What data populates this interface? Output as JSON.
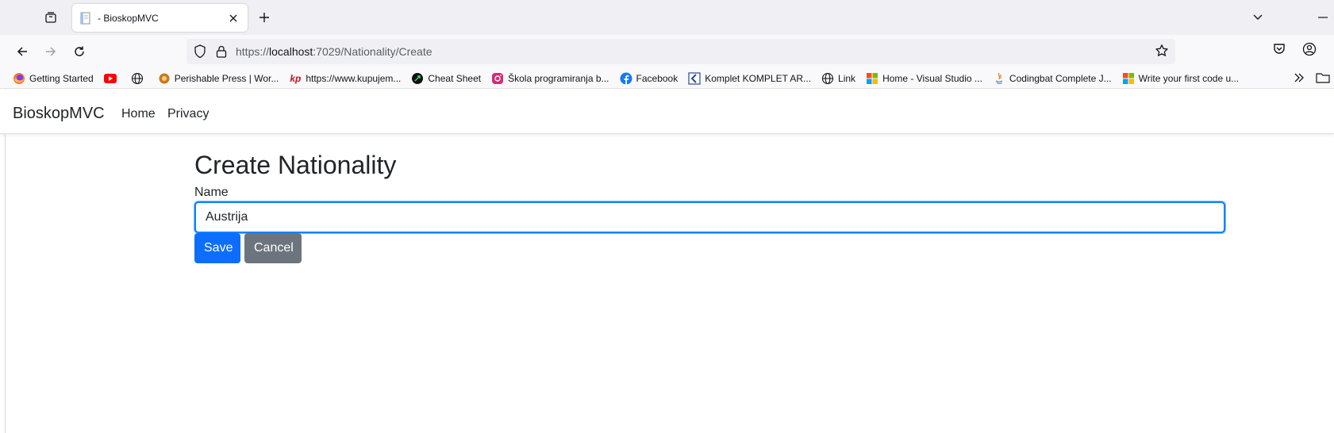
{
  "browser": {
    "tab": {
      "title": "- BioskopMVC"
    },
    "url": {
      "prefix": "https://",
      "host": "localhost",
      "rest": ":7029/Nationality/Create"
    },
    "bookmarks": [
      {
        "label": "Getting Started",
        "icon": "firefox-icon"
      },
      {
        "label": "",
        "icon": "youtube-icon"
      },
      {
        "label": "",
        "icon": "globe-icon"
      },
      {
        "label": "Perishable Press | Wor...",
        "icon": "perishable-icon"
      },
      {
        "label": "https://www.kupujem...",
        "icon": "kp-icon"
      },
      {
        "label": "Cheat Sheet",
        "icon": "cheatsheet-icon"
      },
      {
        "label": "Škola programiranja b...",
        "icon": "instagram-icon"
      },
      {
        "label": "Facebook",
        "icon": "facebook-icon"
      },
      {
        "label": "Komplet KOMPLET AR...",
        "icon": "komplet-icon"
      },
      {
        "label": "Link",
        "icon": "globe-icon"
      },
      {
        "label": "Home - Visual Studio ...",
        "icon": "microsoft-icon"
      },
      {
        "label": "Codingbat Complete J...",
        "icon": "java-icon"
      },
      {
        "label": "Write your first code u...",
        "icon": "microsoft-icon"
      }
    ]
  },
  "site": {
    "brand": "BioskopMVC",
    "nav": [
      "Home",
      "Privacy"
    ]
  },
  "form": {
    "title": "Create Nationality",
    "name_label": "Name",
    "name_value": "Austrija",
    "save_label": "Save",
    "cancel_label": "Cancel"
  },
  "colors": {
    "primary": "#0d6efd",
    "secondary": "#6c757d",
    "focus": "#0a84ff"
  }
}
